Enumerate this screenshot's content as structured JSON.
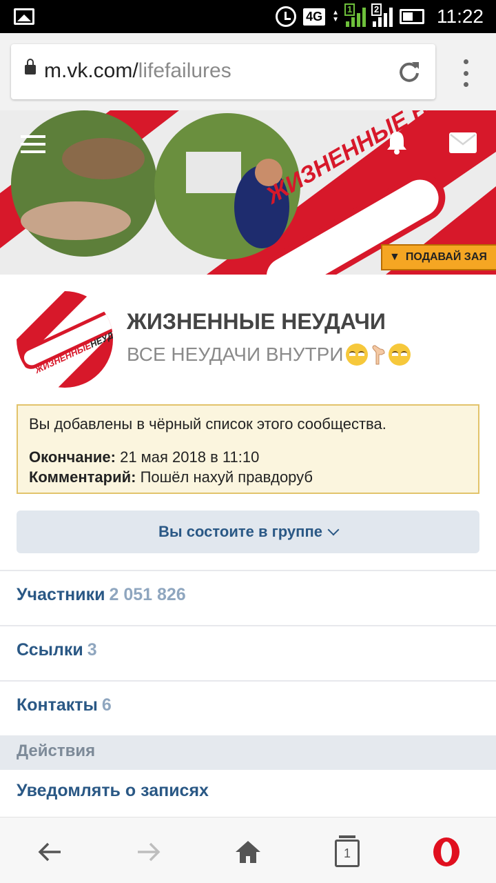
{
  "status_bar": {
    "network": "4G",
    "sim1": "1",
    "sim2": "2",
    "time": "11:22"
  },
  "browser": {
    "url_host": "m.vk.com/",
    "url_path": "lifefailures"
  },
  "cover": {
    "logo_text": "ЖИЗНЕННЫЕ НЕУДАЧИ",
    "cta_label": "ПОДАВАЙ ЗАЯ"
  },
  "group": {
    "name": "ЖИЗНЕННЫЕ НЕУДАЧИ",
    "status": "ВСЕ НЕУДАЧИ ВНУТРИ"
  },
  "notice": {
    "message": "Вы добавлены в чёрный список этого сообщества.",
    "end_label": "Окончание:",
    "end_value": "21 мая 2018 в 11:10",
    "comment_label": "Комментарий:",
    "comment_value": "Пошёл нахуй правдоруб"
  },
  "membership_button": "Вы состоите в группе",
  "menu": {
    "members_label": "Участники",
    "members_count": "2 051 826",
    "links_label": "Ссылки",
    "links_count": "3",
    "contacts_label": "Контакты",
    "contacts_count": "6"
  },
  "actions": {
    "heading": "Действия",
    "notify_label": "Уведомлять о записях"
  },
  "bottom_nav": {
    "tabs_count": "1"
  },
  "colors": {
    "vk_link": "#2a5885",
    "count_muted": "#8fa6bf",
    "brand_red": "#d7182a",
    "notice_bg": "#fbf5de",
    "notice_border": "#e2c36a",
    "opera_red": "#e0101f"
  },
  "icons": [
    "gallery-icon",
    "alarm-icon",
    "signal-icon",
    "battery-icon",
    "lock-icon",
    "reload-icon",
    "more-vert-icon",
    "menu-icon",
    "bell-icon",
    "envelope-icon",
    "chevron-down-icon",
    "back-arrow-icon",
    "forward-arrow-icon",
    "home-icon",
    "tabs-icon",
    "opera-icon"
  ]
}
